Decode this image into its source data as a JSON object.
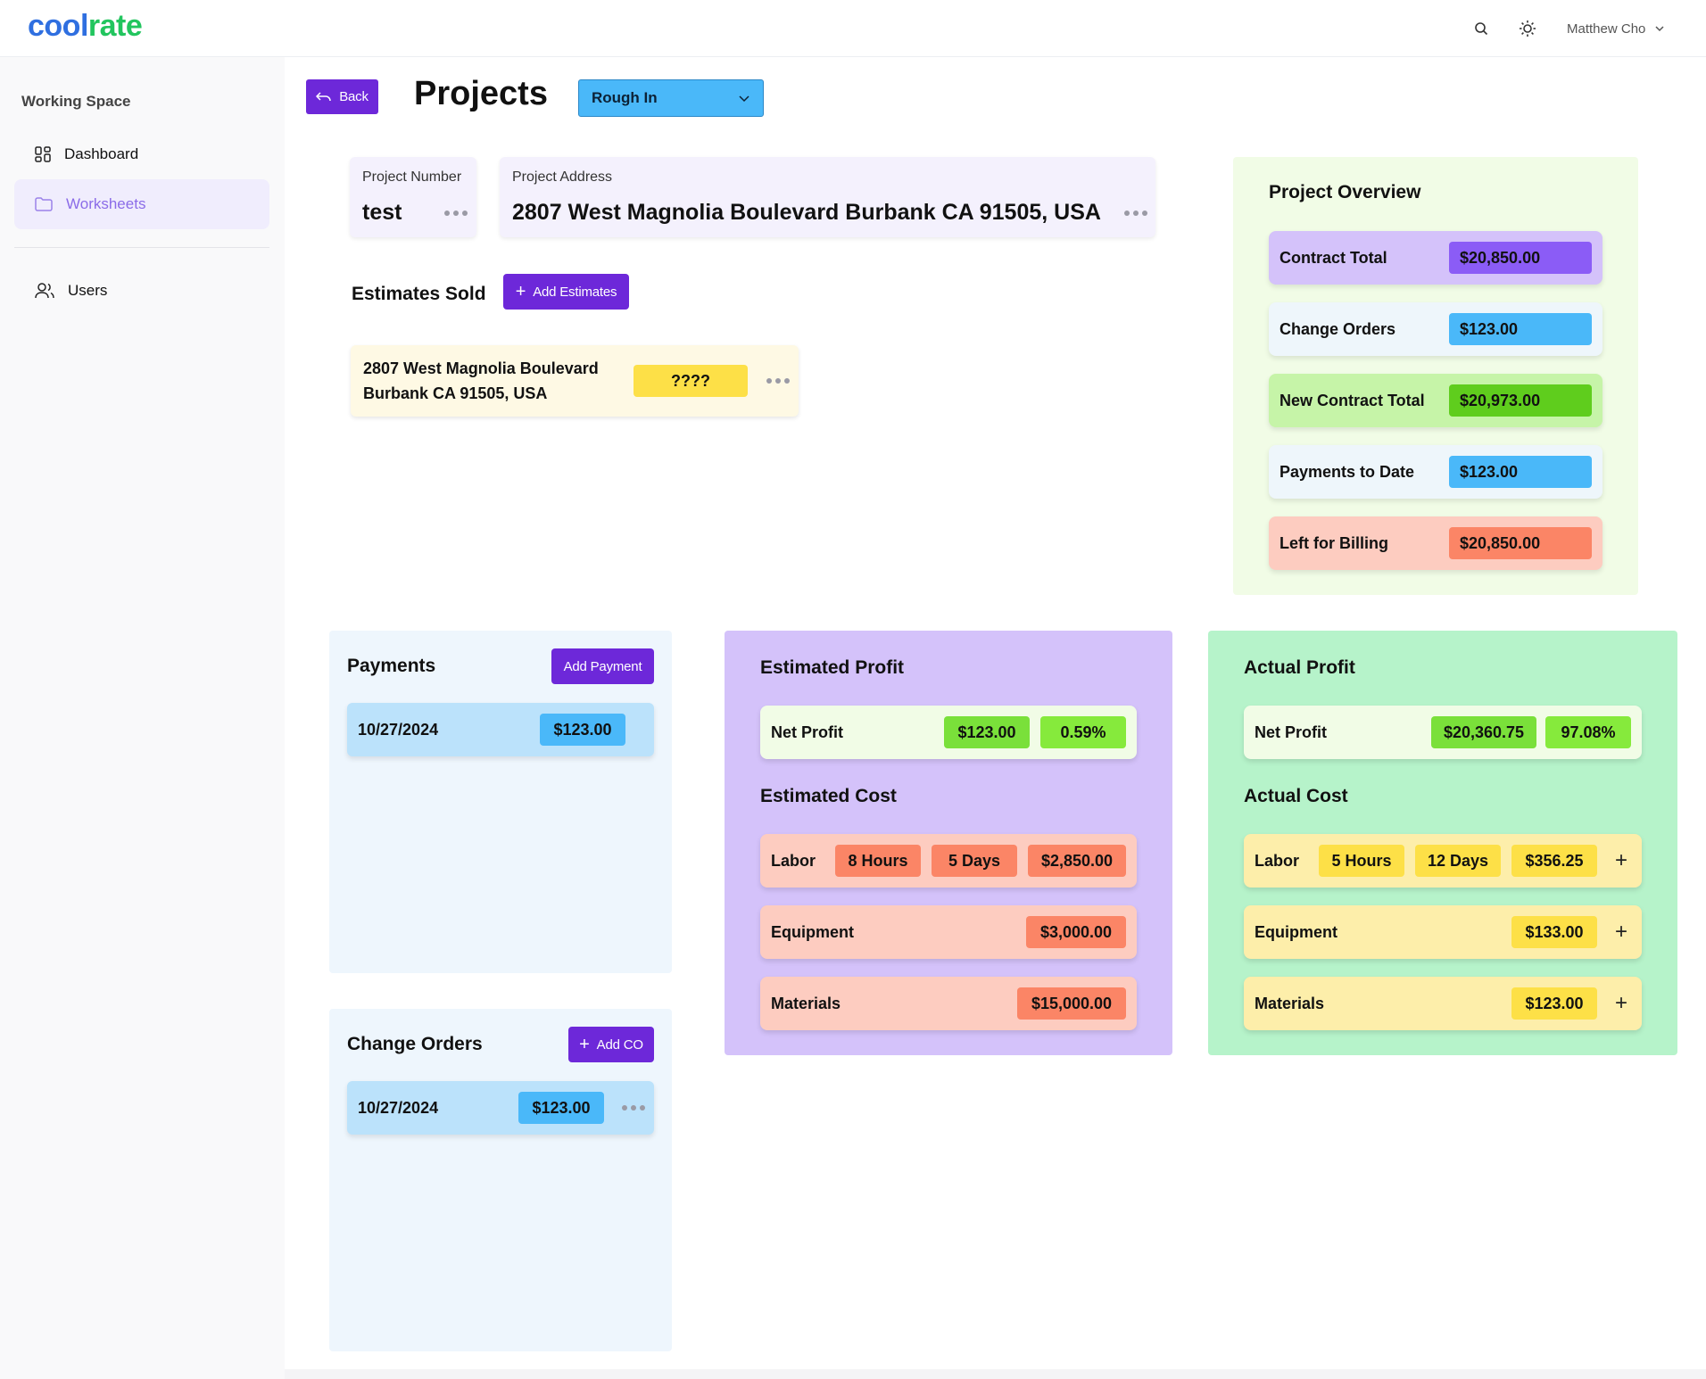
{
  "app": {
    "logo_part1": "cool",
    "logo_part2": "rate",
    "user_name": "Matthew Cho"
  },
  "sidebar": {
    "section_title": "Working Space",
    "items": [
      {
        "label": "Dashboard",
        "icon": "dashboard-grid-icon",
        "active": false
      },
      {
        "label": "Worksheets",
        "icon": "folder-icon",
        "active": true
      },
      {
        "label": "Users",
        "icon": "users-icon",
        "active": false
      }
    ]
  },
  "header": {
    "back_label": "Back",
    "title": "Projects",
    "status_value": "Rough In"
  },
  "project": {
    "number_label": "Project Number",
    "number_value": "test",
    "address_label": "Project Address",
    "address_value": "2807 West Magnolia Boulevard Burbank CA 91505, USA"
  },
  "estimates": {
    "title": "Estimates Sold",
    "add_label": "Add Estimates",
    "items": [
      {
        "address_line1": "2807 West Magnolia Boulevard",
        "address_line2": "Burbank CA 91505, USA",
        "badge": "????"
      }
    ]
  },
  "overview": {
    "title": "Project Overview",
    "rows": [
      {
        "label": "Contract Total",
        "value": "$20,850.00"
      },
      {
        "label": "Change Orders",
        "value": "$123.00"
      },
      {
        "label": "New Contract Total",
        "value": "$20,973.00"
      },
      {
        "label": "Payments to Date",
        "value": "$123.00"
      },
      {
        "label": "Left for Billing",
        "value": "$20,850.00"
      }
    ]
  },
  "payments": {
    "title": "Payments",
    "add_label": "Add Payment",
    "items": [
      {
        "date": "10/27/2024",
        "amount": "$123.00"
      }
    ]
  },
  "change_orders": {
    "title": "Change Orders",
    "add_label": "Add CO",
    "items": [
      {
        "date": "10/27/2024",
        "amount": "$123.00"
      }
    ]
  },
  "estimated": {
    "profit_title": "Estimated Profit",
    "net_label": "Net Profit",
    "net_value": "$123.00",
    "net_percent": "0.59%",
    "cost_title": "Estimated Cost",
    "labor_label": "Labor",
    "labor_hours": "8 Hours",
    "labor_days": "5 Days",
    "labor_value": "$2,850.00",
    "equipment_label": "Equipment",
    "equipment_value": "$3,000.00",
    "materials_label": "Materials",
    "materials_value": "$15,000.00"
  },
  "actual": {
    "profit_title": "Actual Profit",
    "net_label": "Net Profit",
    "net_value": "$20,360.75",
    "net_percent": "97.08%",
    "cost_title": "Actual Cost",
    "labor_label": "Labor",
    "labor_hours": "5 Hours",
    "labor_days": "12 Days",
    "labor_value": "$356.25",
    "equipment_label": "Equipment",
    "equipment_value": "$133.00",
    "materials_label": "Materials",
    "materials_value": "$123.00",
    "add_symbol": "+"
  },
  "colors": {
    "accent_purple": "#6d28d9",
    "status_blue": "#4ab8f9",
    "overview_bg": "#f1fce6",
    "estimated_bg": "#d4c2fa",
    "actual_bg": "#b6f3ca"
  }
}
